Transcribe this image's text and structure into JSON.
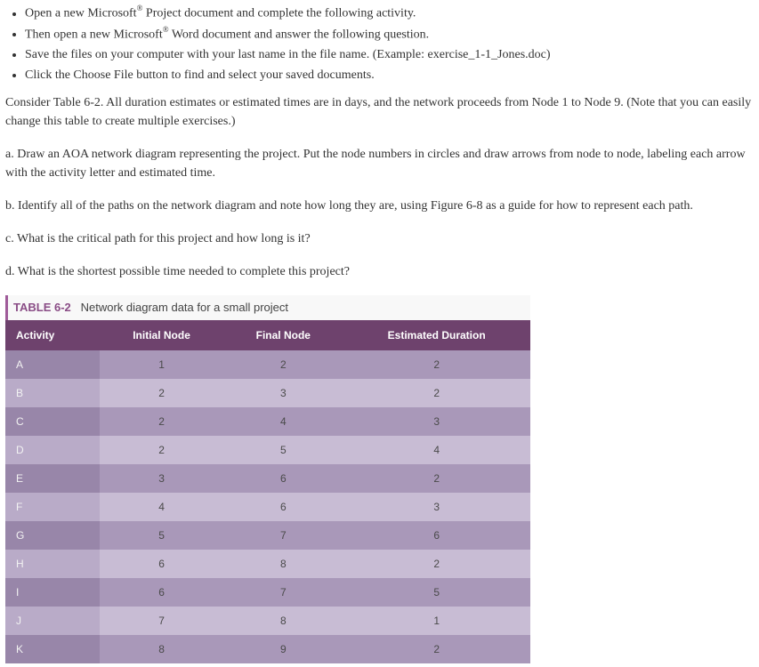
{
  "instructions": [
    {
      "pre": "Open a new Microsoft",
      "sup": "®",
      "post": " Project document and complete the following activity."
    },
    {
      "pre": "Then open a new Microsoft",
      "sup": "®",
      "post": " Word document and answer the following question."
    },
    {
      "pre": "Save the files on your computer with your last name in the file name. (Example: exercise_1-1_Jones.doc)",
      "sup": "",
      "post": ""
    },
    {
      "pre": "Click the Choose File button to find and select your saved documents.",
      "sup": "",
      "post": ""
    }
  ],
  "paragraphs": {
    "intro": "Consider Table 6-2. All duration estimates or estimated times are in days, and the network proceeds from Node 1 to Node 9. (Note that you can easily change this table to create multiple exercises.)",
    "a": "a. Draw an AOA network diagram representing the project. Put the node numbers in circles and draw arrows from node to node, labeling each arrow with the activity letter and estimated time.",
    "b": "b. Identify all of the paths on the network diagram and note how long they are, using Figure 6-8 as a guide for how to represent each path.",
    "c": "c. What is the critical path for this project and how long is it?",
    "d": "d. What is the shortest possible time needed to complete this project?"
  },
  "table": {
    "label": "TABLE 6-2",
    "caption": "Network diagram data for a small project",
    "headers": {
      "activity": "Activity",
      "initial": "Initial Node",
      "final": "Final Node",
      "duration": "Estimated Duration"
    },
    "rows": [
      {
        "activity": "A",
        "initial": "1",
        "final": "2",
        "duration": "2"
      },
      {
        "activity": "B",
        "initial": "2",
        "final": "3",
        "duration": "2"
      },
      {
        "activity": "C",
        "initial": "2",
        "final": "4",
        "duration": "3"
      },
      {
        "activity": "D",
        "initial": "2",
        "final": "5",
        "duration": "4"
      },
      {
        "activity": "E",
        "initial": "3",
        "final": "6",
        "duration": "2"
      },
      {
        "activity": "F",
        "initial": "4",
        "final": "6",
        "duration": "3"
      },
      {
        "activity": "G",
        "initial": "5",
        "final": "7",
        "duration": "6"
      },
      {
        "activity": "H",
        "initial": "6",
        "final": "8",
        "duration": "2"
      },
      {
        "activity": "I",
        "initial": "6",
        "final": "7",
        "duration": "5"
      },
      {
        "activity": "J",
        "initial": "7",
        "final": "8",
        "duration": "1"
      },
      {
        "activity": "K",
        "initial": "8",
        "final": "9",
        "duration": "2"
      }
    ]
  }
}
